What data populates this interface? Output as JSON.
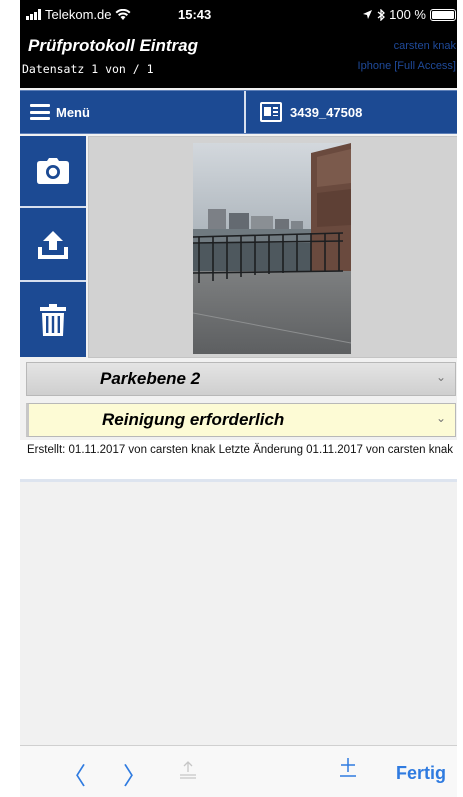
{
  "status_bar": {
    "carrier": "Telekom.de",
    "time": "15:43",
    "battery": "100 %"
  },
  "header": {
    "title": "Prüfprotokoll Eintrag",
    "record_counter": "Datensatz 1  von /  1",
    "user": "carsten knak",
    "access": "Iphone [Full Access]"
  },
  "navbar": {
    "menu_label": "Menü",
    "record_label": "3439_47508"
  },
  "actions": [
    {
      "icon": "camera-icon"
    },
    {
      "icon": "upload-icon"
    },
    {
      "icon": "trash-icon"
    }
  ],
  "fields": {
    "location": "Parkebene 2",
    "status": "Reinigung erforderlich"
  },
  "meta": {
    "text": "Erstellt: 01.11.2017 von carsten knak Letzte Änderung  01.11.2017 von carsten knak"
  },
  "toolbar": {
    "done_label": "Fertig"
  },
  "colors": {
    "header_bg": "#000000",
    "nav_blue": "#1c4a93",
    "ios_blue": "#2f7be0",
    "status_field_bg": "#fdfbd5"
  }
}
